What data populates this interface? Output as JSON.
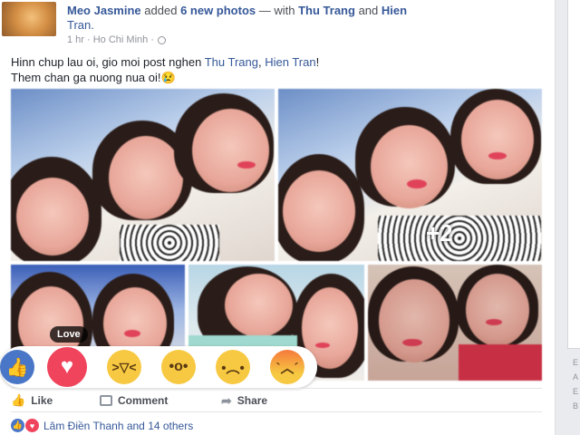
{
  "post": {
    "author": "Meo Jasmine",
    "action_prefix": "added",
    "photo_count_text": "6 new photos",
    "with_text": "— with",
    "tagged_1": "Thu Trang",
    "and_text": "and",
    "tagged_2_part1": "Hien",
    "tagged_2_part2": "Tran.",
    "time": "1 hr · Ho Chi Minh ·",
    "caption_line1_a": "Hinn chup lau oi, gio moi post nghen",
    "caption_tag1": "Thu Trang",
    "caption_sep": ",",
    "caption_tag2": "Hien Tran",
    "caption_line1_end": "!",
    "caption_line2": "Them chan ga nuong nua oi!😢",
    "more_photos": "+2"
  },
  "reactions": {
    "tooltip": "Love",
    "icons": [
      "like-icon",
      "love-icon",
      "haha-icon",
      "wow-icon",
      "sad-icon",
      "angry-icon"
    ]
  },
  "actions": {
    "like": "Like",
    "comment": "Comment",
    "share": "Share"
  },
  "summary": {
    "text": "Lâm Điền Thanh and 14 others"
  },
  "side": {
    "letters": [
      "E",
      "A",
      "E",
      "B"
    ]
  },
  "colors": {
    "link": "#365899",
    "like_blue": "#4a76c7",
    "love_red": "#f0435c",
    "emoji_yellow": "#f7c942"
  }
}
